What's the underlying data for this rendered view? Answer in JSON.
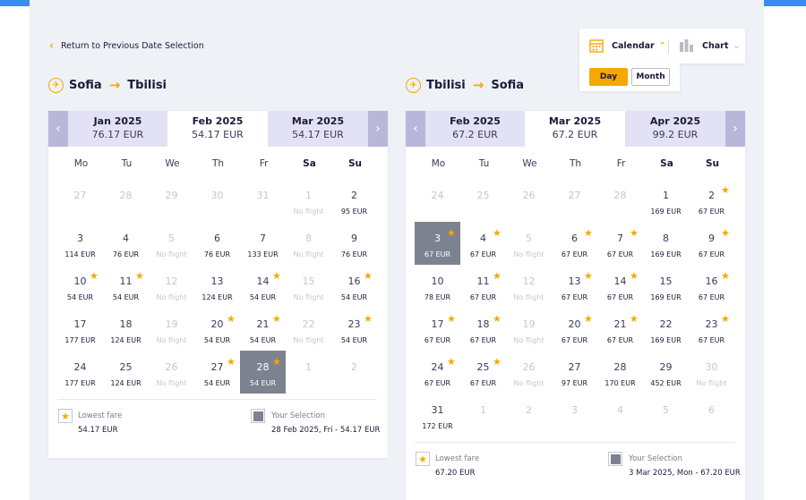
{
  "return_link": "Return to Previous Date Selection",
  "view_toggle": {
    "calendar": "Calendar",
    "chart": "Chart",
    "day": "Day",
    "month": "Month"
  },
  "colors": {
    "accent": "#f5a800",
    "selected": "#7d8290",
    "nav": "#b9b7d9"
  },
  "dows": [
    "Mo",
    "Tu",
    "We",
    "Th",
    "Fr",
    "Sa",
    "Su"
  ],
  "outbound": {
    "from": "Sofia",
    "to": "Tbilisi",
    "tabs": [
      {
        "month": "Jan 2025",
        "price": "76.17 EUR"
      },
      {
        "month": "Feb 2025",
        "price": "54.17 EUR"
      },
      {
        "month": "Mar 2025",
        "price": "54.17 EUR"
      }
    ],
    "weeks": [
      [
        {
          "d": "27",
          "o": 1
        },
        {
          "d": "28",
          "o": 1
        },
        {
          "d": "29",
          "o": 1
        },
        {
          "d": "30",
          "o": 1
        },
        {
          "d": "31",
          "o": 1
        },
        {
          "d": "1",
          "p": "No flight",
          "nf": 1
        },
        {
          "d": "2",
          "p": "95 EUR"
        }
      ],
      [
        {
          "d": "3",
          "p": "114 EUR"
        },
        {
          "d": "4",
          "p": "76 EUR"
        },
        {
          "d": "5",
          "p": "No flight",
          "nf": 1
        },
        {
          "d": "6",
          "p": "76 EUR"
        },
        {
          "d": "7",
          "p": "133 EUR"
        },
        {
          "d": "8",
          "p": "No flight",
          "nf": 1
        },
        {
          "d": "9",
          "p": "76 EUR"
        }
      ],
      [
        {
          "d": "10",
          "p": "54 EUR",
          "s": 1
        },
        {
          "d": "11",
          "p": "54 EUR",
          "s": 1
        },
        {
          "d": "12",
          "p": "No flight",
          "nf": 1
        },
        {
          "d": "13",
          "p": "124 EUR"
        },
        {
          "d": "14",
          "p": "54 EUR",
          "s": 1
        },
        {
          "d": "15",
          "p": "No flight",
          "nf": 1
        },
        {
          "d": "16",
          "p": "54 EUR",
          "s": 1
        }
      ],
      [
        {
          "d": "17",
          "p": "177 EUR"
        },
        {
          "d": "18",
          "p": "124 EUR"
        },
        {
          "d": "19",
          "p": "No flight",
          "nf": 1
        },
        {
          "d": "20",
          "p": "54 EUR",
          "s": 1
        },
        {
          "d": "21",
          "p": "54 EUR",
          "s": 1
        },
        {
          "d": "22",
          "p": "No flight",
          "nf": 1
        },
        {
          "d": "23",
          "p": "54 EUR",
          "s": 1
        }
      ],
      [
        {
          "d": "24",
          "p": "177 EUR"
        },
        {
          "d": "25",
          "p": "124 EUR"
        },
        {
          "d": "26",
          "p": "No flight",
          "nf": 1
        },
        {
          "d": "27",
          "p": "54 EUR",
          "s": 1
        },
        {
          "d": "28",
          "p": "54 EUR",
          "s": 1,
          "sel": 1
        },
        {
          "d": "1",
          "o": 1
        },
        {
          "d": "2",
          "o": 1
        }
      ]
    ],
    "lowest_label": "Lowest fare",
    "lowest_value": "54.17 EUR",
    "selection_label": "Your Selection",
    "selection_value": "28 Feb 2025, Fri - 54.17 EUR"
  },
  "inbound": {
    "from": "Tbilisi",
    "to": "Sofia",
    "tabs": [
      {
        "month": "Feb 2025",
        "price": "67.2 EUR"
      },
      {
        "month": "Mar 2025",
        "price": "67.2 EUR"
      },
      {
        "month": "Apr 2025",
        "price": "99.2 EUR"
      }
    ],
    "weeks": [
      [
        {
          "d": "24",
          "o": 1
        },
        {
          "d": "25",
          "o": 1
        },
        {
          "d": "26",
          "o": 1
        },
        {
          "d": "27",
          "o": 1
        },
        {
          "d": "28",
          "o": 1
        },
        {
          "d": "1",
          "p": "169 EUR"
        },
        {
          "d": "2",
          "p": "67 EUR",
          "s": 1
        }
      ],
      [
        {
          "d": "3",
          "p": "67 EUR",
          "s": 1,
          "sel": 1
        },
        {
          "d": "4",
          "p": "67 EUR",
          "s": 1
        },
        {
          "d": "5",
          "p": "No flight",
          "nf": 1
        },
        {
          "d": "6",
          "p": "67 EUR",
          "s": 1
        },
        {
          "d": "7",
          "p": "67 EUR",
          "s": 1
        },
        {
          "d": "8",
          "p": "169 EUR"
        },
        {
          "d": "9",
          "p": "67 EUR",
          "s": 1
        }
      ],
      [
        {
          "d": "10",
          "p": "78 EUR"
        },
        {
          "d": "11",
          "p": "67 EUR",
          "s": 1
        },
        {
          "d": "12",
          "p": "No flight",
          "nf": 1
        },
        {
          "d": "13",
          "p": "67 EUR",
          "s": 1
        },
        {
          "d": "14",
          "p": "67 EUR",
          "s": 1
        },
        {
          "d": "15",
          "p": "169 EUR"
        },
        {
          "d": "16",
          "p": "67 EUR",
          "s": 1
        }
      ],
      [
        {
          "d": "17",
          "p": "67 EUR",
          "s": 1
        },
        {
          "d": "18",
          "p": "67 EUR",
          "s": 1
        },
        {
          "d": "19",
          "p": "No flight",
          "nf": 1
        },
        {
          "d": "20",
          "p": "67 EUR",
          "s": 1
        },
        {
          "d": "21",
          "p": "67 EUR",
          "s": 1
        },
        {
          "d": "22",
          "p": "169 EUR"
        },
        {
          "d": "23",
          "p": "67 EUR",
          "s": 1
        }
      ],
      [
        {
          "d": "24",
          "p": "67 EUR",
          "s": 1
        },
        {
          "d": "25",
          "p": "67 EUR",
          "s": 1
        },
        {
          "d": "26",
          "p": "No flight",
          "nf": 1
        },
        {
          "d": "27",
          "p": "97 EUR"
        },
        {
          "d": "28",
          "p": "170 EUR"
        },
        {
          "d": "29",
          "p": "452 EUR"
        },
        {
          "d": "30",
          "p": "No flight",
          "nf": 1
        }
      ],
      [
        {
          "d": "31",
          "p": "172 EUR"
        },
        {
          "d": "1",
          "o": 1
        },
        {
          "d": "2",
          "o": 1
        },
        {
          "d": "3",
          "o": 1
        },
        {
          "d": "4",
          "o": 1
        },
        {
          "d": "5",
          "o": 1
        },
        {
          "d": "6",
          "o": 1
        }
      ]
    ],
    "lowest_label": "Lowest fare",
    "lowest_value": "67.20 EUR",
    "selection_label": "Your Selection",
    "selection_value": "3 Mar 2025, Mon - 67.20 EUR"
  }
}
